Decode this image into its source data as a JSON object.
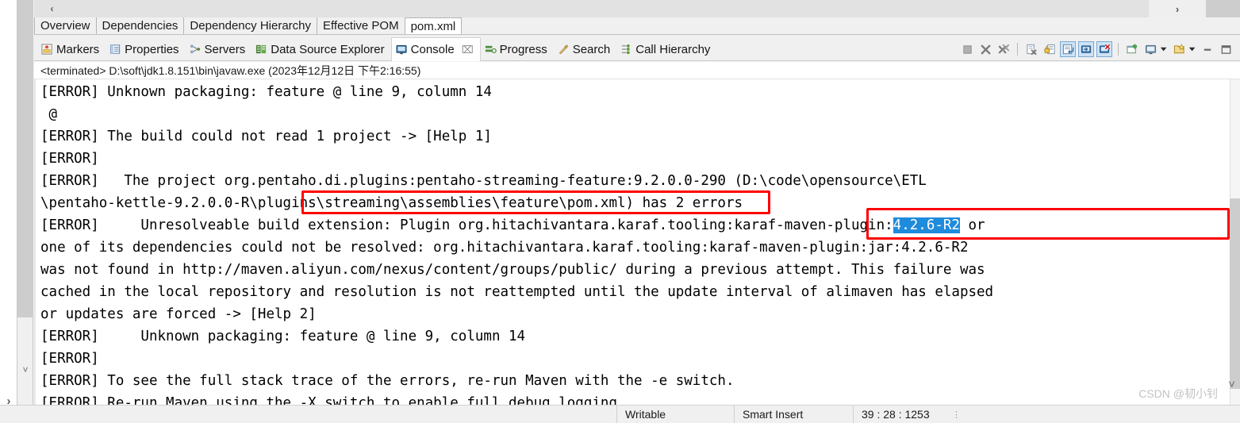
{
  "window": {
    "scroll_left_label": "‹",
    "scroll_right_label": "›",
    "left_strip_arrow": "›",
    "left_chevron": "˅"
  },
  "editor_tabs": [
    {
      "label": "Overview",
      "active": false
    },
    {
      "label": "Dependencies",
      "active": false
    },
    {
      "label": "Dependency Hierarchy",
      "active": false
    },
    {
      "label": "Effective POM",
      "active": false
    },
    {
      "label": "pom.xml",
      "active": true
    }
  ],
  "view_tabs": [
    {
      "label": "Markers",
      "icon": "markers-icon",
      "active": false,
      "closeable": false
    },
    {
      "label": "Properties",
      "icon": "properties-icon",
      "active": false,
      "closeable": false
    },
    {
      "label": "Servers",
      "icon": "servers-icon",
      "active": false,
      "closeable": false
    },
    {
      "label": "Data Source Explorer",
      "icon": "data-source-explorer-icon",
      "active": false,
      "closeable": false
    },
    {
      "label": "Console",
      "icon": "console-icon",
      "active": true,
      "closeable": true,
      "close_label": "⌧"
    },
    {
      "label": "Progress",
      "icon": "progress-icon",
      "active": false,
      "closeable": false
    },
    {
      "label": "Search",
      "icon": "search-icon",
      "active": false,
      "closeable": false
    },
    {
      "label": "Call Hierarchy",
      "icon": "call-hierarchy-icon",
      "active": false,
      "closeable": false
    }
  ],
  "toolbar": [
    {
      "name": "terminate-button",
      "icon": "stop-square-icon",
      "toggled": false
    },
    {
      "name": "remove-launch-button",
      "icon": "remove-x-icon",
      "toggled": false
    },
    {
      "name": "remove-all-terminated-button",
      "icon": "remove-all-x-icon",
      "toggled": false
    },
    {
      "name": "separator-1",
      "icon": "separator",
      "toggled": false
    },
    {
      "name": "clear-console-button",
      "icon": "clear-console-icon",
      "toggled": false
    },
    {
      "name": "scroll-lock-button",
      "icon": "scroll-lock-icon",
      "toggled": false
    },
    {
      "name": "word-wrap-button",
      "icon": "word-wrap-icon",
      "toggled": true
    },
    {
      "name": "show-console-on-output-button",
      "icon": "show-console-output-icon",
      "toggled": true
    },
    {
      "name": "show-console-on-error-button",
      "icon": "show-console-error-icon",
      "toggled": true
    },
    {
      "name": "separator-2",
      "icon": "separator",
      "toggled": false
    },
    {
      "name": "pin-console-button",
      "icon": "pin-console-icon",
      "toggled": false
    },
    {
      "name": "display-selected-console-button",
      "icon": "display-console-icon",
      "toggled": false
    },
    {
      "name": "display-selected-console-menu",
      "icon": "chevron-down-icon",
      "toggled": false
    },
    {
      "name": "open-console-button",
      "icon": "open-console-icon",
      "toggled": false
    },
    {
      "name": "open-console-menu",
      "icon": "chevron-down-icon",
      "toggled": false
    },
    {
      "name": "minimize-button",
      "icon": "minimize-icon",
      "toggled": false
    },
    {
      "name": "maximize-button",
      "icon": "maximize-icon",
      "toggled": false
    }
  ],
  "console": {
    "header": "<terminated> D:\\soft\\jdk1.8.151\\bin\\javaw.exe (2023年12月12日 下午2:16:55)",
    "lines": [
      "[ERROR] Unknown packaging: feature @ line 9, column 14",
      " @",
      "[ERROR] The build could not read 1 project -> [Help 1]",
      "[ERROR]",
      "[ERROR]   The project org.pentaho.di.plugins:pentaho-streaming-feature:9.2.0.0-290 (D:\\code\\opensource\\ETL",
      "\\pentaho-kettle-9.2.0.0-R\\plugins\\streaming\\assemblies\\feature\\pom.xml) has 2 errors",
      "[ERROR]     Unresolveable build extension: Plugin org.hitachivantara.karaf.tooling:karaf-maven-plugin:",
      "one of its dependencies could not be resolved: org.hitachivantara.karaf.tooling:karaf-maven-plugin:jar:4.2.6-R2",
      "was not found in http://maven.aliyun.com/nexus/content/groups/public/ during a previous attempt. This failure was",
      "cached in the local repository and resolution is not reattempted until the update interval of alimaven has elapsed",
      "or updates are forced -> [Help 2]",
      "[ERROR]     Unknown packaging: feature @ line 9, column 14",
      "[ERROR]",
      "[ERROR] To see the full stack trace of the errors, re-run Maven with the -e switch.",
      "[ERROR] Re-run Maven using the -X switch to enable full debug logging."
    ],
    "selection_text": "4.2.6-R2",
    "selection_suffix": " or",
    "selection_color": "#1e8bdc"
  },
  "annotations": {
    "color": "#ff0000",
    "box_1_label": "pom-path-highlight",
    "box_2_label": "plugin-version-highlight"
  },
  "statusbar": {
    "writable": "Writable",
    "insert_mode": "Smart Insert",
    "position": "39 : 28 : 1253",
    "dots": "⋮"
  },
  "watermark": {
    "text": "CSDN @韧小钊"
  }
}
